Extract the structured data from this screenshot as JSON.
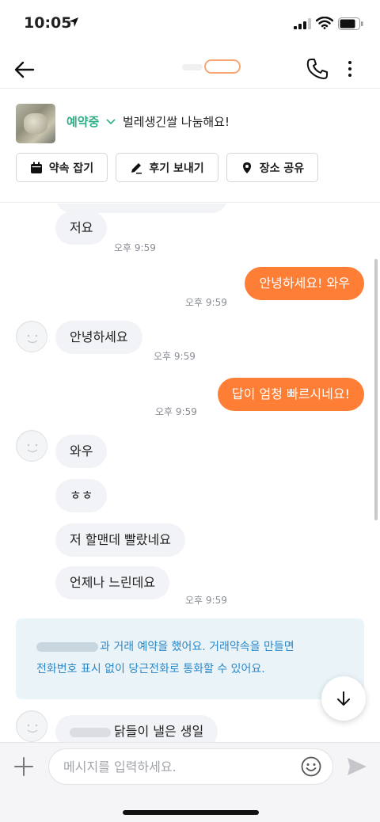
{
  "status_bar": {
    "time": "10:05"
  },
  "header": {
    "partner_name": ""
  },
  "product": {
    "status": "예약중",
    "title": "벌레생긴쌀 나눔해요!",
    "buttons": {
      "appointment": "약속 잡기",
      "review": "후기 보내기",
      "place": "장소 공유"
    }
  },
  "messages": [
    {
      "text": "저요",
      "time": "오후 9:59"
    },
    {
      "text": "안녕하세요! 와우",
      "time": "오후 9:59"
    },
    {
      "text": "안녕하세요",
      "time": "오후 9:59"
    },
    {
      "text": "답이 엄청 빠르시네요!",
      "time": "오후 9:59"
    },
    {
      "text": "와우"
    },
    {
      "text": "ㅎㅎ"
    },
    {
      "text": "저 할맨데 빨랐네요"
    },
    {
      "text": "언제나 느린데요",
      "time": "오후 9:59"
    }
  ],
  "notice": {
    "line1": "과 거래 예약을 했어요. 거래약속을 만들면",
    "line2": "전화번호 표시 없이 당근전화로 통화할 수 있어요."
  },
  "partial_message": "닭들이 낼은 생일",
  "input": {
    "placeholder": "메시지를 입력하세요."
  },
  "colors": {
    "accent": "#ff7e36",
    "reserved_green": "#2fae87",
    "notice_blue": "#2a87c8"
  }
}
